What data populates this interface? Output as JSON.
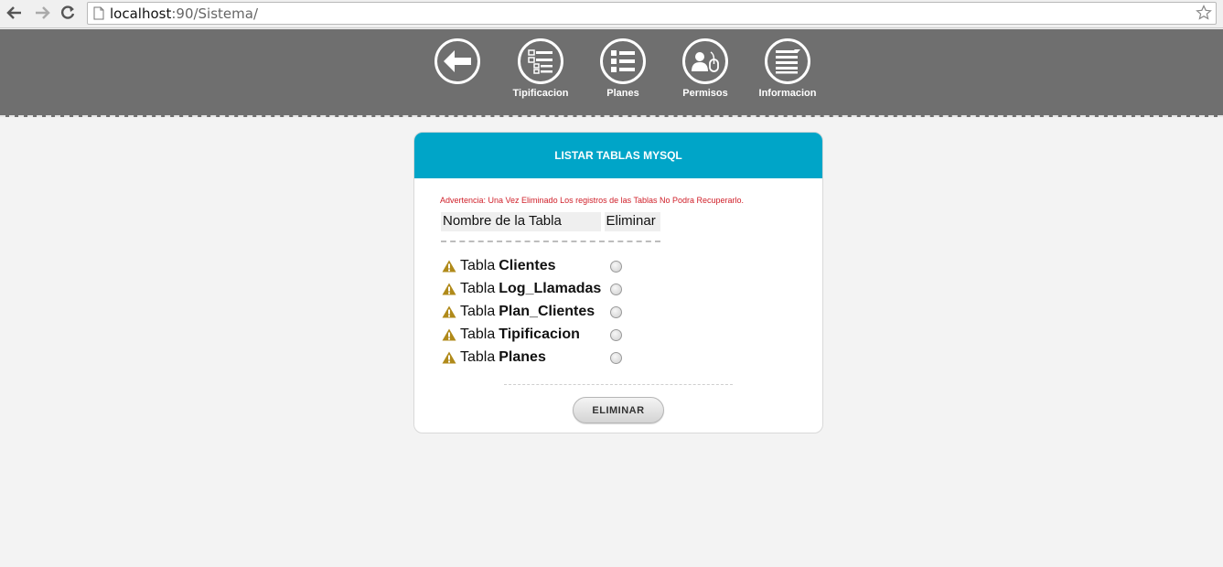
{
  "browser": {
    "url_host": "localhost",
    "url_rest": ":90/Sistema/"
  },
  "menu": {
    "items": [
      {
        "label": "",
        "icon": "back-arrow-icon"
      },
      {
        "label": "Tipificacion",
        "icon": "tree-list-icon"
      },
      {
        "label": "Planes",
        "icon": "list-icon"
      },
      {
        "label": "Permisos",
        "icon": "user-mouse-icon"
      },
      {
        "label": "Informacion",
        "icon": "document-lines-icon"
      }
    ]
  },
  "panel": {
    "title": "LISTAR TABLAS MYSQL",
    "warning": "Advertencia: Una Vez Eliminado Los registros de las Tablas No Podra Recuperarlo.",
    "columns": [
      "Nombre de la Tabla",
      "Eliminar"
    ],
    "row_prefix": "Tabla",
    "rows": [
      {
        "name": "Clientes"
      },
      {
        "name": "Log_Llamadas"
      },
      {
        "name": "Plan_Clientes"
      },
      {
        "name": "Tipificacion"
      },
      {
        "name": "Planes"
      }
    ],
    "delete_button": "ELIMINAR"
  },
  "colors": {
    "header_bg": "#6f6f6f",
    "panel_head": "#00a5c8",
    "warning_text": "#d0202a",
    "warning_icon": "#b08a1a"
  }
}
